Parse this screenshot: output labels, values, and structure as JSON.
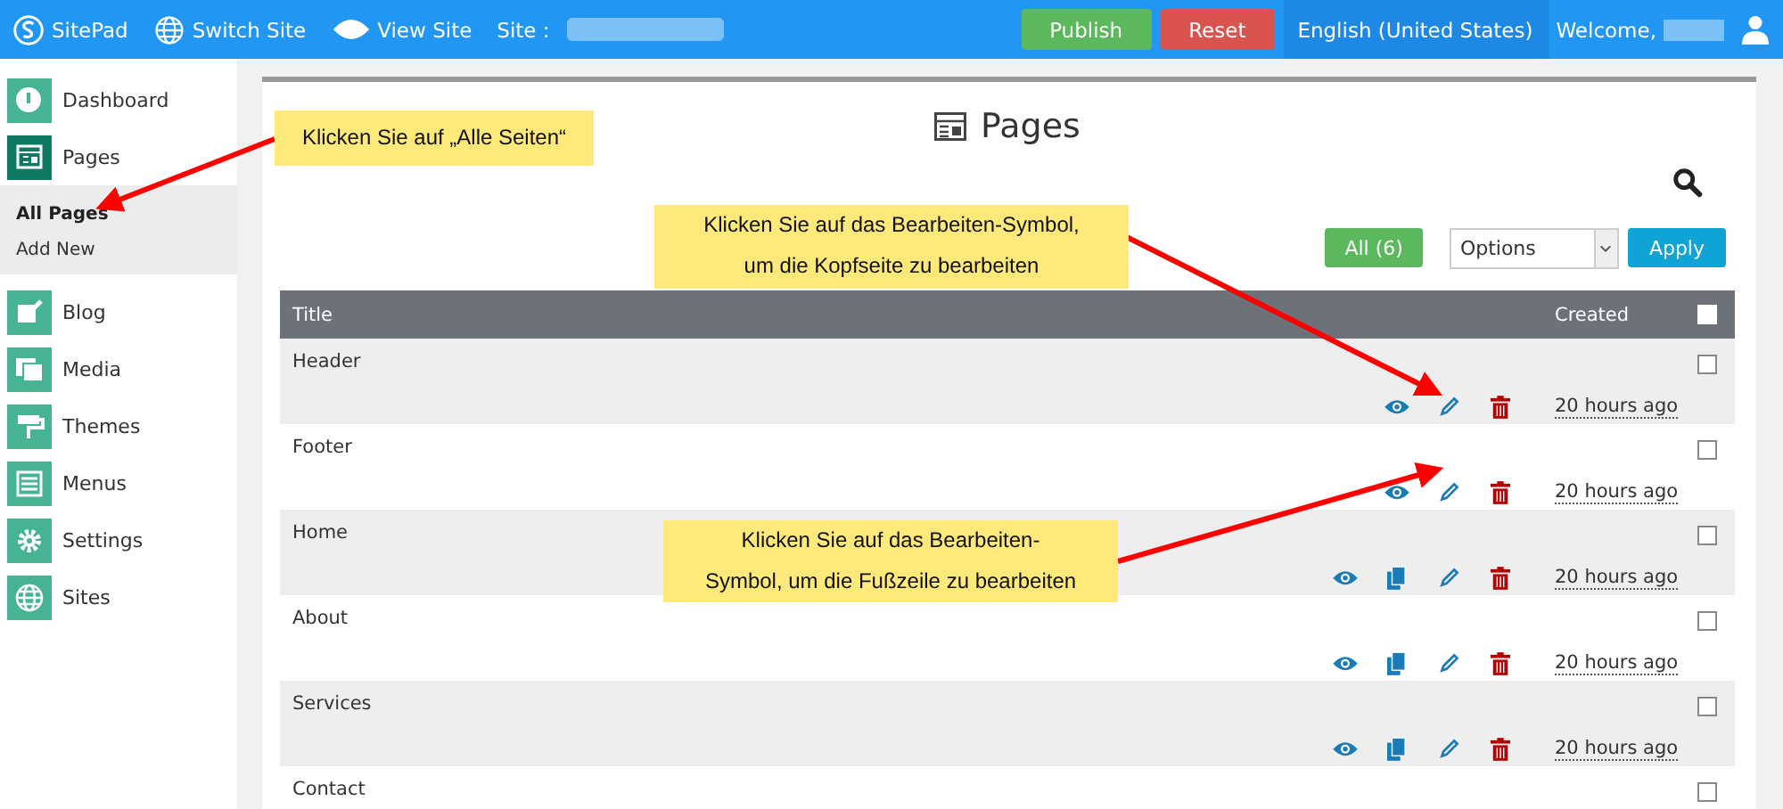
{
  "topbar": {
    "brand": "SitePad",
    "links": [
      {
        "kind": "globe",
        "label": "Switch Site"
      },
      {
        "kind": "eye",
        "label": "View Site"
      }
    ],
    "site_label": "Site :",
    "publish": "Publish",
    "reset": "Reset",
    "language": "English (United States)",
    "welcome": "Welcome,"
  },
  "sidebar": {
    "items": [
      {
        "kind": "dashboard",
        "label": "Dashboard",
        "selected": false
      },
      {
        "kind": "pages",
        "label": "Pages",
        "selected": true,
        "children": [
          {
            "label": "All Pages",
            "selected": true
          },
          {
            "label": "Add New",
            "selected": false
          }
        ]
      },
      {
        "kind": "blog",
        "label": "Blog",
        "selected": false
      },
      {
        "kind": "media",
        "label": "Media",
        "selected": false
      },
      {
        "kind": "themes",
        "label": "Themes",
        "selected": false
      },
      {
        "kind": "menus",
        "label": "Menus",
        "selected": false
      },
      {
        "kind": "settings",
        "label": "Settings",
        "selected": false
      },
      {
        "kind": "sites",
        "label": "Sites",
        "selected": false
      }
    ]
  },
  "page": {
    "title": "Pages",
    "filter": "All (6)",
    "bulk_select": {
      "value": "Options"
    },
    "apply": "Apply",
    "table": {
      "columns": [
        "Title",
        "Created"
      ],
      "select_all": {
        "checked": false
      },
      "rows": [
        {
          "title": "Header",
          "actions": [
            {
              "kind": "view"
            },
            {
              "kind": "edit"
            },
            {
              "kind": "delete"
            }
          ],
          "created": "20 hours ago",
          "checked": false
        },
        {
          "title": "Footer",
          "actions": [
            {
              "kind": "view"
            },
            {
              "kind": "edit"
            },
            {
              "kind": "delete"
            }
          ],
          "created": "20 hours ago",
          "checked": false
        },
        {
          "title": "Home",
          "actions": [
            {
              "kind": "view"
            },
            {
              "kind": "copy"
            },
            {
              "kind": "edit"
            },
            {
              "kind": "delete"
            }
          ],
          "created": "20 hours ago",
          "checked": false
        },
        {
          "title": "About",
          "actions": [
            {
              "kind": "view"
            },
            {
              "kind": "copy"
            },
            {
              "kind": "edit"
            },
            {
              "kind": "delete"
            }
          ],
          "created": "20 hours ago",
          "checked": false
        },
        {
          "title": "Services",
          "actions": [
            {
              "kind": "view"
            },
            {
              "kind": "copy"
            },
            {
              "kind": "edit"
            },
            {
              "kind": "delete"
            }
          ],
          "created": "20 hours ago",
          "checked": false
        },
        {
          "title": "Contact",
          "checked": false
        }
      ]
    }
  },
  "annotations": [
    {
      "text": "Klicken Sie auf „Alle Seiten“"
    },
    {
      "text": "Klicken Sie auf das Bearbeiten-Symbol,\num die Kopfseite zu bearbeiten"
    },
    {
      "text": "Klicken Sie auf das Bearbeiten-\nSymbol, um die Fußzeile zu bearbeiten"
    }
  ]
}
